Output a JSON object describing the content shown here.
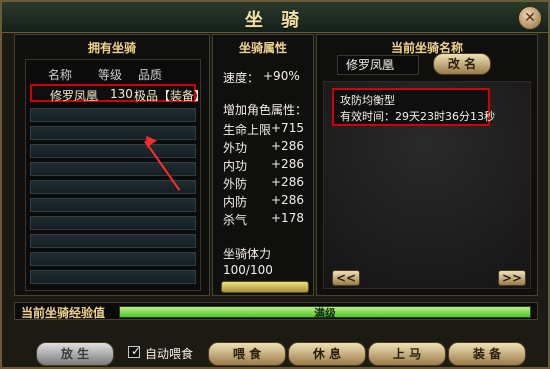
{
  "title": "坐 骑",
  "close": "✕",
  "left_panel": {
    "header": "拥有坐骑",
    "columns": [
      "名称",
      "等级",
      "品质"
    ],
    "selected": {
      "name": "修罗凤凰",
      "level": "130",
      "quality": "极品【装备】"
    }
  },
  "mid_panel": {
    "header": "坐骑属性",
    "speed_label": "速度：",
    "speed_value": "+90%",
    "attr_title": "增加角色属性：",
    "stats": [
      {
        "label": "生命上限",
        "value": "+715"
      },
      {
        "label": "外功",
        "value": "+286"
      },
      {
        "label": "内功",
        "value": "+286"
      },
      {
        "label": "外防",
        "value": "+286"
      },
      {
        "label": "内防",
        "value": "+286"
      },
      {
        "label": "杀气",
        "value": "+178"
      }
    ],
    "stamina_label": "坐骑体力",
    "stamina_value": "100/100"
  },
  "right_panel": {
    "header": "当前坐骑名称",
    "current_name": "修罗凤凰",
    "rename_button": "改 名",
    "info_line1": "攻防均衡型",
    "info_line2": "有效时间：29天23时36分13秒",
    "prev_button": "<<",
    "next_button": ">>"
  },
  "exp": {
    "label": "当前坐骑经验值",
    "progress": 1.0,
    "text": "满级"
  },
  "bottom": {
    "release": "放 生",
    "auto_feed_label": "自动喂食",
    "auto_feed_checked": true,
    "feed": "喂 食",
    "rest": "休 息",
    "ride": "上 马",
    "equip": "装 备"
  }
}
